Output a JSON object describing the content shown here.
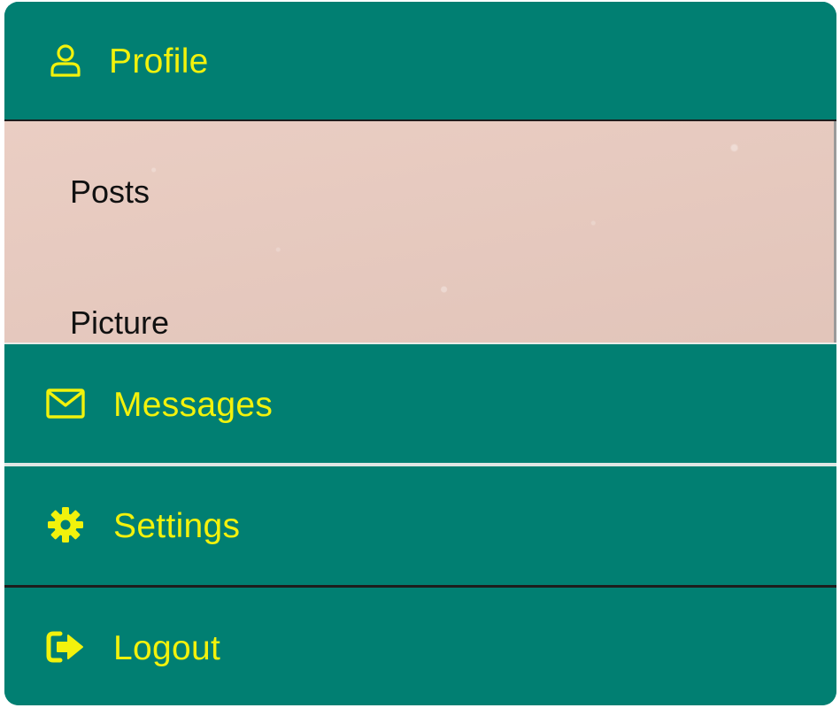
{
  "menu": {
    "items": [
      {
        "label": "Profile",
        "icon": "user-icon"
      },
      {
        "label": "Messages",
        "icon": "envelope-icon"
      },
      {
        "label": "Settings",
        "icon": "gear-icon"
      },
      {
        "label": "Logout",
        "icon": "logout-icon"
      }
    ],
    "profile_submenu": [
      {
        "label": "Posts"
      },
      {
        "label": "Picture"
      }
    ]
  },
  "colors": {
    "menu_background": "#017f72",
    "label_text": "#f2f20c",
    "submenu_background": "#e9cbc0",
    "submenu_text": "#111111"
  }
}
